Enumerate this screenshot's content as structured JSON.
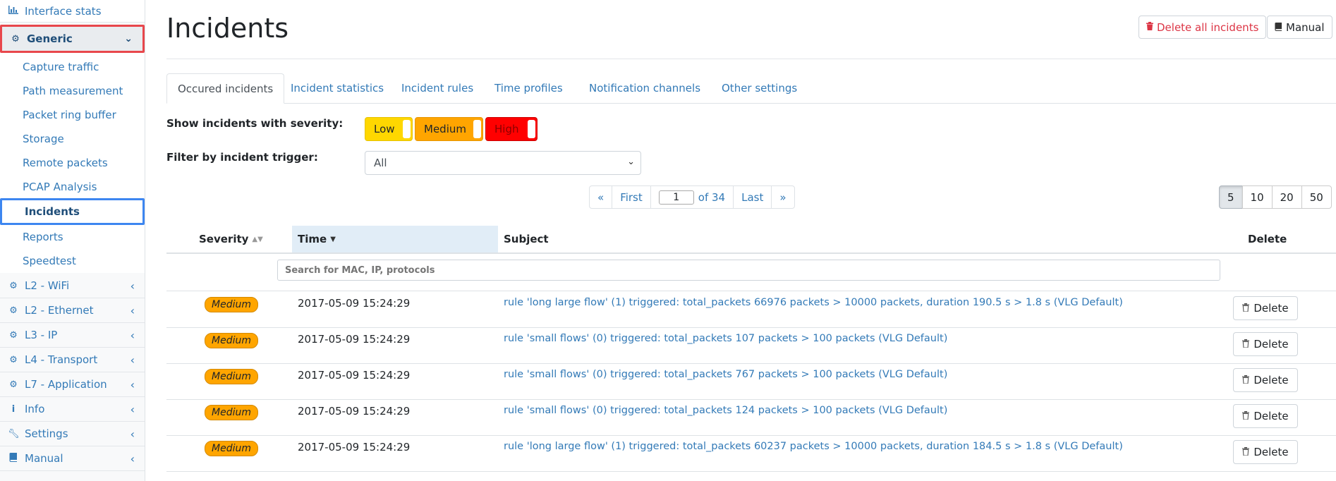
{
  "sidebar": {
    "top_item": {
      "icon": "bar-chart-icon",
      "label": "Interface stats"
    },
    "generic": {
      "icon": "gear-icon",
      "label": "Generic"
    },
    "sub_items": [
      "Capture traffic",
      "Path measurement",
      "Packet ring buffer",
      "Storage",
      "Remote packets",
      "PCAP Analysis"
    ],
    "active_item": "Incidents",
    "sub_items_after": [
      "Reports",
      "Speedtest"
    ],
    "sections": [
      {
        "icon": "gear-icon",
        "label": "L2 - WiFi"
      },
      {
        "icon": "gear-icon",
        "label": "L2 - Ethernet"
      },
      {
        "icon": "gear-icon",
        "label": "L3 - IP"
      },
      {
        "icon": "gear-icon",
        "label": "L4 - Transport"
      },
      {
        "icon": "gear-icon",
        "label": "L7 - Application"
      },
      {
        "icon": "info-icon",
        "label": "Info"
      },
      {
        "icon": "wrench-icon",
        "label": "Settings"
      },
      {
        "icon": "book-icon",
        "label": "Manual"
      }
    ]
  },
  "header": {
    "title": "Incidents",
    "delete_all_label": "Delete all incidents",
    "manual_label": "Manual"
  },
  "tabs": [
    "Occured incidents",
    "Incident statistics",
    "Incident rules",
    "Time profiles",
    "Notification channels",
    "Other settings"
  ],
  "active_tab": "Occured incidents",
  "filters": {
    "severity_label": "Show incidents with severity:",
    "severity_options": {
      "low": "Low",
      "medium": "Medium",
      "high": "High"
    },
    "trigger_label": "Filter by incident trigger:",
    "trigger_value": "All"
  },
  "pagination": {
    "prev": "«",
    "first": "First",
    "current_page": "1",
    "of_text": "of 34",
    "last": "Last",
    "next": "»",
    "page_sizes": [
      "5",
      "10",
      "20",
      "50"
    ],
    "active_page_size": "5"
  },
  "table": {
    "headers": {
      "severity": "Severity",
      "time": "Time",
      "subject": "Subject",
      "delete": "Delete"
    },
    "search_placeholder": "Search for MAC, IP, protocols",
    "delete_label": "Delete",
    "rows": [
      {
        "severity": "Medium",
        "time": "2017-05-09 15:24:29",
        "subject": "rule 'long large flow' (1) triggered: total_packets 66976 packets > 10000 packets, duration 190.5 s > 1.8 s (VLG Default)"
      },
      {
        "severity": "Medium",
        "time": "2017-05-09 15:24:29",
        "subject": "rule 'small flows' (0) triggered: total_packets 107 packets > 100 packets (VLG Default)"
      },
      {
        "severity": "Medium",
        "time": "2017-05-09 15:24:29",
        "subject": "rule 'small flows' (0) triggered: total_packets 767 packets > 100 packets (VLG Default)"
      },
      {
        "severity": "Medium",
        "time": "2017-05-09 15:24:29",
        "subject": "rule 'small flows' (0) triggered: total_packets 124 packets > 100 packets (VLG Default)"
      },
      {
        "severity": "Medium",
        "time": "2017-05-09 15:24:29",
        "subject": "rule 'long large flow' (1) triggered: total_packets 60237 packets > 10000 packets, duration 184.5 s > 1.8 s (VLG Default)"
      }
    ]
  },
  "colors": {
    "link": "#337ab7",
    "low": "#ffd700",
    "medium": "#ffa500",
    "high": "#ff0000",
    "danger": "#dc3545"
  }
}
